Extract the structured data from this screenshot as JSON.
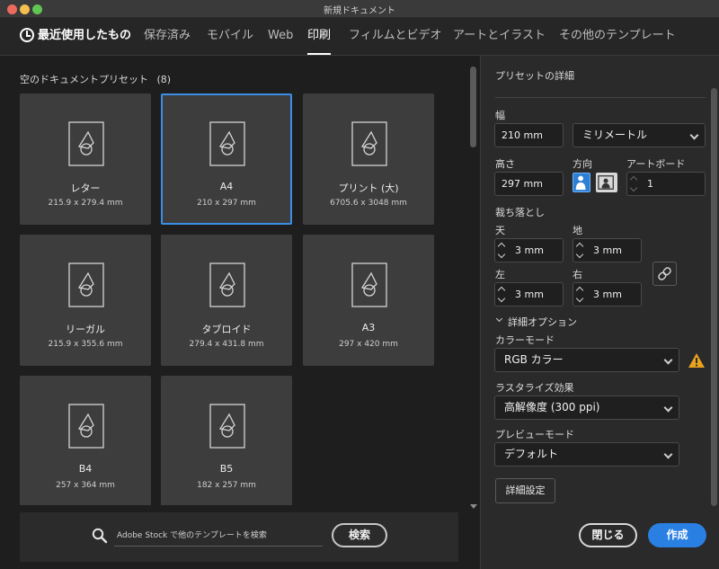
{
  "window": {
    "title": "新規ドキュメント"
  },
  "nav": {
    "tabs": [
      {
        "label": "最近使用したもの"
      },
      {
        "label": "保存済み"
      },
      {
        "label": "モバイル"
      },
      {
        "label": "Web"
      },
      {
        "label": "印刷"
      },
      {
        "label": "フィルムとビデオ"
      },
      {
        "label": "アートとイラスト"
      },
      {
        "label": "その他のテンプレート"
      }
    ],
    "active": "印刷"
  },
  "presets": {
    "section_title": "空のドキュメントプリセット",
    "count": "(8)",
    "items": [
      {
        "name": "レター",
        "size": "215.9 x 279.4 mm"
      },
      {
        "name": "A4",
        "size": "210 x 297 mm"
      },
      {
        "name": "プリント (大)",
        "size": "6705.6 x 3048 mm"
      },
      {
        "name": "リーガル",
        "size": "215.9 x 355.6 mm"
      },
      {
        "name": "タブロイド",
        "size": "279.4 x 431.8 mm"
      },
      {
        "name": "A3",
        "size": "297 x 420 mm"
      },
      {
        "name": "B4",
        "size": "257 x 364 mm"
      },
      {
        "name": "B5",
        "size": "182 x 257 mm"
      }
    ],
    "selected": "A4"
  },
  "search": {
    "placeholder": "Adobe Stock で他のテンプレートを検索",
    "button": "検索"
  },
  "details": {
    "title": "プリセットの詳細",
    "width_label": "幅",
    "width_value": "210 mm",
    "unit": "ミリメートル",
    "height_label": "高さ",
    "height_value": "297 mm",
    "orientation_label": "方向",
    "artboard_label": "アートボード",
    "artboard_value": "1",
    "bleed_label": "裁ち落とし",
    "bleed_top_label": "天",
    "bleed_top": "3 mm",
    "bleed_bottom_label": "地",
    "bleed_bottom": "3 mm",
    "bleed_left_label": "左",
    "bleed_left": "3 mm",
    "bleed_right_label": "右",
    "bleed_right": "3 mm",
    "advanced_toggle": "詳細オプション",
    "color_mode_label": "カラーモード",
    "color_mode": "RGB カラー",
    "raster_label": "ラスタライズ効果",
    "raster": "高解像度 (300 ppi)",
    "preview_label": "プレビューモード",
    "preview": "デフォルト",
    "advanced_settings": "詳細設定",
    "close": "閉じる",
    "create": "作成",
    "accent": "#2a7fe3",
    "warning_color": "#e8a21f"
  }
}
